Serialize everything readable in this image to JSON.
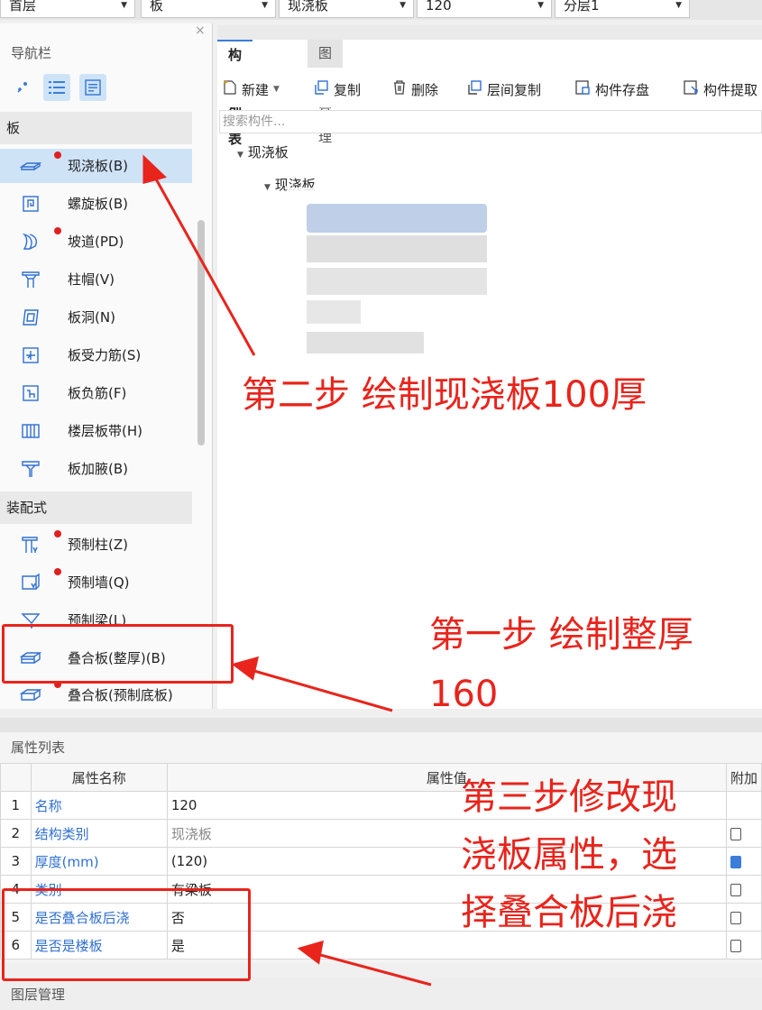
{
  "top_selectors": [
    {
      "value": "首层"
    },
    {
      "value": "板"
    },
    {
      "value": "现浇板"
    },
    {
      "value": "120"
    },
    {
      "value": "分层1"
    }
  ],
  "nav": {
    "title": "导航栏",
    "close": "×",
    "groups": [
      {
        "label": "板",
        "items": [
          {
            "label": "现浇板(B)",
            "icon": "slab-icon",
            "dot": true,
            "selected": true
          },
          {
            "label": "螺旋板(B)",
            "icon": "spiral-slab-icon",
            "dot": false
          },
          {
            "label": "坡道(PD)",
            "icon": "ramp-icon",
            "dot": true
          },
          {
            "label": "柱帽(V)",
            "icon": "column-cap-icon",
            "dot": false
          },
          {
            "label": "板洞(N)",
            "icon": "slab-hole-icon",
            "dot": false
          },
          {
            "label": "板受力筋(S)",
            "icon": "slab-rebar-icon",
            "dot": false
          },
          {
            "label": "板负筋(F)",
            "icon": "negative-rebar-icon",
            "dot": false
          },
          {
            "label": "楼层板带(H)",
            "icon": "slab-strip-icon",
            "dot": false
          },
          {
            "label": "板加腋(B)",
            "icon": "slab-haunch-icon",
            "dot": false
          }
        ]
      },
      {
        "label": "装配式",
        "items": [
          {
            "label": "预制柱(Z)",
            "icon": "precast-column-icon",
            "dot": true
          },
          {
            "label": "预制墙(Q)",
            "icon": "precast-wall-icon",
            "dot": true
          },
          {
            "label": "预制梁(L)",
            "icon": "precast-beam-icon",
            "dot": false
          },
          {
            "label": "叠合板(整厚)(B)",
            "icon": "composite-slab-icon",
            "dot": false
          },
          {
            "label": "叠合板(预制底板)",
            "icon": "composite-slab-base-icon",
            "dot": true
          }
        ]
      }
    ]
  },
  "tabs": [
    {
      "label": "构件列表",
      "active": true
    },
    {
      "label": "图纸管理",
      "active": false
    }
  ],
  "toolbar": {
    "new": "新建",
    "copy": "复制",
    "delete": "删除",
    "floor_copy": "层间复制",
    "save": "构件存盘",
    "extract": "构件提取"
  },
  "search": {
    "placeholder": "搜索构件..."
  },
  "tree": {
    "root": "现浇板",
    "child": "现浇板"
  },
  "properties": {
    "title": "属性列表",
    "headers": [
      "属性名称",
      "属性值",
      "附加"
    ],
    "rows": [
      {
        "no": "1",
        "name": "名称",
        "value": "120",
        "check": null
      },
      {
        "no": "2",
        "name": "结构类别",
        "value": "现浇板",
        "check": "off"
      },
      {
        "no": "3",
        "name": "厚度(mm)",
        "value": "(120)",
        "check": "on"
      },
      {
        "no": "4",
        "name": "类别",
        "value": "有梁板",
        "check": "off"
      },
      {
        "no": "5",
        "name": "是否叠合板后浇",
        "value": "否",
        "check": "off"
      },
      {
        "no": "6",
        "name": "是否是楼板",
        "value": "是",
        "check": "off"
      }
    ]
  },
  "layer_panel": {
    "title": "图层管理"
  },
  "annotations": {
    "step1_line1": "第一步 绘制整厚",
    "step1_line2": "160",
    "step2": "第二步 绘制现浇板100厚",
    "step3_line1": "第三步修改现",
    "step3_line2": "浇板属性，选",
    "step3_line3": "择叠合板后浇"
  },
  "colors": {
    "annotation": "#e8241c",
    "accent": "#3b7dd8",
    "selected_row": "#cfe3f7"
  }
}
